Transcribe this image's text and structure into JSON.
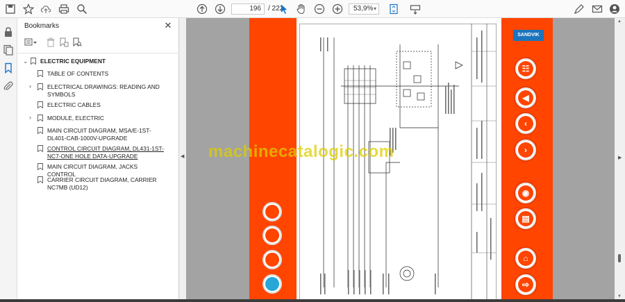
{
  "toolbar": {
    "page_current": "196",
    "page_total": "/ 222",
    "zoom": "53,9%"
  },
  "bookmarks": {
    "title": "Bookmarks",
    "items": [
      {
        "label": "ELECTRIC EQUIPMENT"
      },
      {
        "label": "TABLE OF CONTENTS"
      },
      {
        "label": "ELECTRICAL DRAWINGS: READING AND SYMBOLS"
      },
      {
        "label": "ELECTRIC CABLES"
      },
      {
        "label": "MODULE, ELECTRIC"
      },
      {
        "label": "MAIN CIRCUIT DIAGRAM, MSA/E-1ST-DL401-CAB-1000V-UPGRADE"
      },
      {
        "label": "CONTROL CIRCUIT DIAGRAM, DL431-1ST-NC7-ONE HOLE DATA-UPGRADE"
      },
      {
        "label": "MAIN CIRCUIT DIAGRAM, JACKS CONTROL"
      },
      {
        "label": "CARRIER CIRCUIT DIAGRAM, CARRIER NC7MB (UD12)"
      }
    ]
  },
  "document": {
    "brand": "SANDVIK",
    "watermark": "machinecatalogic.com"
  },
  "colors": {
    "accent_orange": "#ff4500",
    "viewer_bg": "#a3a3a3",
    "brand_blue": "#1c74bc"
  }
}
